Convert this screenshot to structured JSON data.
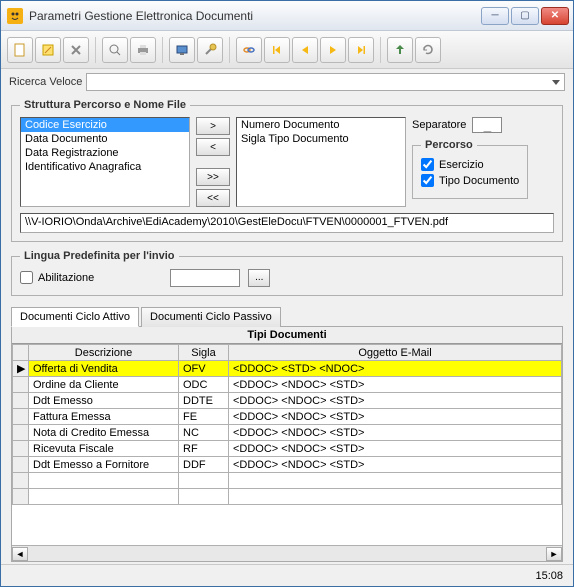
{
  "window": {
    "title": "Parametri Gestione Elettronica Documenti"
  },
  "quicksearch": {
    "label": "Ricerca Veloce"
  },
  "structGroup": {
    "legend": "Struttura Percorso e Nome File",
    "leftList": [
      "Codice Esercizio",
      "Data Documento",
      "Data Registrazione",
      "Identificativo Anagrafica"
    ],
    "rightList": [
      "Numero Documento",
      "Sigla Tipo Documento"
    ],
    "btn_add": ">",
    "btn_remove": "<",
    "btn_addall": ">>",
    "btn_removeall": "<<",
    "sepLabel": "Separatore",
    "sepValue": "_",
    "pathGroup": {
      "legend": "Percorso",
      "chkEsercizio": "Esercizio",
      "chkTipoDoc": "Tipo Documento"
    },
    "path": "\\\\V-IORIO\\Onda\\Archive\\EdiAcademy\\2010\\GestEleDocu\\FTVEN\\0000001_FTVEN.pdf"
  },
  "langGroup": {
    "legend": "Lingua Predefinita per l'invio",
    "chkLabel": "Abilitazione",
    "browseLabel": "..."
  },
  "tabs": {
    "attivo": "Documenti Ciclo Attivo",
    "passivo": "Documenti Ciclo Passivo"
  },
  "grid": {
    "title": "Tipi Documenti",
    "cols": {
      "desc": "Descrizione",
      "sigla": "Sigla",
      "ogg": "Oggetto E-Mail"
    },
    "rows": [
      {
        "desc": "Offerta di Vendita",
        "sigla": "OFV",
        "ogg": "<DDOC> <STD> <NDOC>"
      },
      {
        "desc": "Ordine da Cliente",
        "sigla": "ODC",
        "ogg": "<DDOC> <NDOC> <STD>"
      },
      {
        "desc": "Ddt Emesso",
        "sigla": "DDTE",
        "ogg": "<DDOC> <NDOC> <STD>"
      },
      {
        "desc": "Fattura Emessa",
        "sigla": "FE",
        "ogg": "<DDOC> <NDOC> <STD>"
      },
      {
        "desc": "Nota di Credito Emessa",
        "sigla": "NC",
        "ogg": "<DDOC> <NDOC> <STD>"
      },
      {
        "desc": "Ricevuta Fiscale",
        "sigla": "RF",
        "ogg": "<DDOC> <NDOC> <STD>"
      },
      {
        "desc": "Ddt Emesso a Fornitore",
        "sigla": "DDF",
        "ogg": "<DDOC> <NDOC> <STD>"
      }
    ]
  },
  "status": {
    "time": "15:08"
  }
}
